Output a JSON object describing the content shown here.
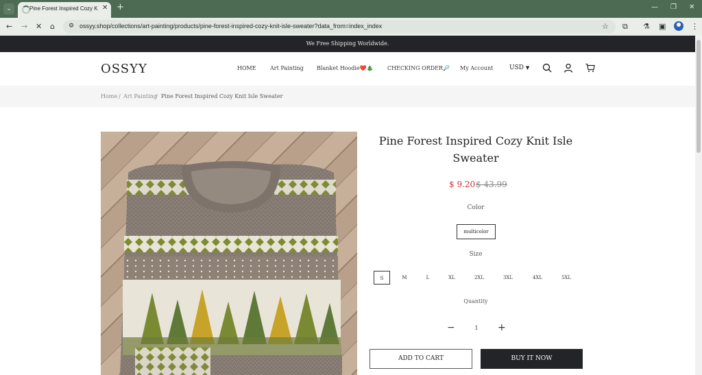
{
  "browser": {
    "tab_title": "Pine Forest Inspired Cozy Knit Isle",
    "tab_close": "✕",
    "new_tab": "+",
    "url": "ossyy.shop/collections/art-painting/products/pine-forest-inspired-cozy-knit-isle-sweater?data_from=index_index"
  },
  "announcement": "We Free Shipping Worldwide.",
  "header": {
    "logo": "OSSYY",
    "nav": [
      "HOME",
      "Art Painting",
      "Blanket Hoodie❤️🎄",
      "CHECKING ORDER🔎",
      "My Account"
    ],
    "currency": "USD"
  },
  "breadcrumb": {
    "home": "Home",
    "sep": "/",
    "category": "Art Painting",
    "current": "Pine Forest Inspired Cozy Knit Isle Sweater"
  },
  "product": {
    "title": "Pine Forest Inspired Cozy Knit Isle Sweater",
    "price": "$ 9.20",
    "compare_price": "$ 43.99",
    "color_label": "Color",
    "color_value": "multicolor",
    "size_label": "Size",
    "sizes": [
      "S",
      "M",
      "L",
      "XL",
      "2XL",
      "3XL",
      "4XL",
      "5XL"
    ],
    "selected_size": "S",
    "quantity_label": "Quantity",
    "quantity": "1",
    "add_to_cart": "ADD TO CART",
    "buy_now": "BUY IT NOW"
  },
  "colors": {
    "sale": "#d32f3a",
    "dark": "#222427",
    "chrome": "#4d6b52"
  }
}
